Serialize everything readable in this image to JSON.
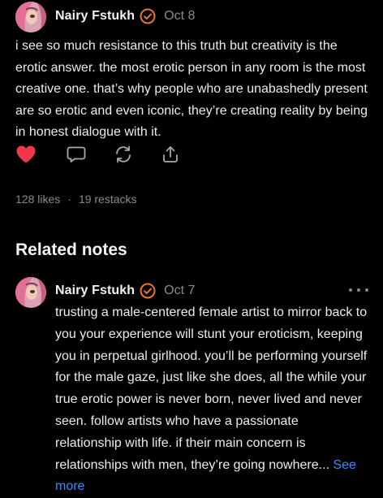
{
  "post": {
    "author": "Nairy Fstukh",
    "date": "Oct 8",
    "text": "i see so much resistance to this truth but creativity is the erotic answer. the most erotic person in any room is the most creative one. that’s why people who are unabashedly present are so erotic and even iconic, they’re creating reality by being in honest dialogue with it.",
    "likes": "128 likes",
    "separator": "·",
    "restacks": "19 restacks",
    "liked": true
  },
  "related": {
    "title": "Related notes",
    "note": {
      "author": "Nairy Fstukh",
      "date": "Oct 7",
      "text": "trusting a male-centered female artist to mirror back to you your experience will stunt your eroticism, keeping you in perpetual girlhood. you’ll be performing yourself for the male gaze, just like she does, all the while your true erotic power is never born, never lived and never seen. follow artists who have a passionate relationship with life. if their main concern is relationships with men, they’re going nowhere...",
      "see_more": "See more"
    }
  },
  "icons": {
    "like": "heart-icon",
    "comment": "comment-icon",
    "restack": "restack-icon",
    "share": "share-icon",
    "verified": "verified-badge-icon",
    "more": "more-options-icon"
  },
  "colors": {
    "background": "#000000",
    "accent_orange": "#e8772e",
    "like_red": "#f0384a",
    "link_blue": "#3b8cf5",
    "muted": "#8a8a8e"
  }
}
